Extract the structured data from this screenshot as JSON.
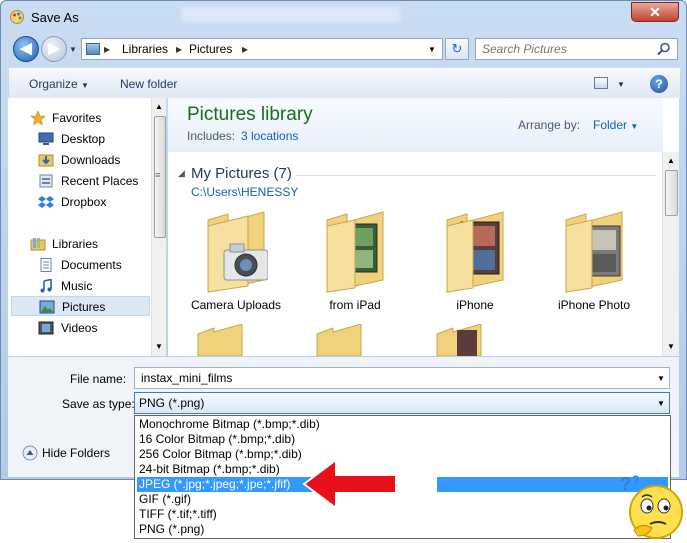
{
  "window": {
    "title": "Save As",
    "close_glyph": "✕"
  },
  "nav": {
    "back_glyph": "◀",
    "forward_glyph": "▶"
  },
  "address": {
    "crumbs": [
      "Libraries",
      "Pictures"
    ],
    "separator": "▸",
    "refresh_glyph": "↻"
  },
  "search": {
    "placeholder": "Search Pictures"
  },
  "toolbar": {
    "organize_label": "Organize",
    "new_folder_label": "New folder",
    "help_glyph": "?"
  },
  "sidebar": {
    "items": [
      {
        "label": "Favorites",
        "icon": "star-icon",
        "group": true
      },
      {
        "label": "Desktop",
        "icon": "desktop-icon"
      },
      {
        "label": "Downloads",
        "icon": "downloads-icon"
      },
      {
        "label": "Recent Places",
        "icon": "recent-places-icon"
      },
      {
        "label": "Dropbox",
        "icon": "dropbox-icon"
      },
      {
        "label": "Libraries",
        "icon": "libraries-icon",
        "group": true
      },
      {
        "label": "Documents",
        "icon": "documents-icon"
      },
      {
        "label": "Music",
        "icon": "music-icon"
      },
      {
        "label": "Pictures",
        "icon": "pictures-icon",
        "selected": true
      },
      {
        "label": "Videos",
        "icon": "videos-icon"
      }
    ]
  },
  "library": {
    "title": "Pictures library",
    "includes_label": "Includes:",
    "includes_link": "3 locations",
    "arrange_label": "Arrange by:",
    "arrange_value": "Folder"
  },
  "group": {
    "heading": "My Pictures (7)",
    "path": "C:\\Users\\HENESSY"
  },
  "folders": [
    {
      "label": "Camera Uploads",
      "overlay": "camera"
    },
    {
      "label": "from iPad",
      "overlay": "photos"
    },
    {
      "label": "iPhone",
      "overlay": "photos"
    },
    {
      "label": "iPhone Photo",
      "overlay": "photos"
    }
  ],
  "form": {
    "file_name_label": "File name:",
    "file_name_value": "instax_mini_films",
    "save_type_label": "Save as type:",
    "save_type_value": "PNG (*.png)",
    "hide_folders_label": "Hide Folders"
  },
  "save_type_options": [
    "Monochrome Bitmap (*.bmp;*.dib)",
    "16 Color Bitmap (*.bmp;*.dib)",
    "256 Color Bitmap (*.bmp;*.dib)",
    "24-bit Bitmap (*.bmp;*.dib)",
    "JPEG (*.jpg;*.jpeg;*.jpe;*.jfif)",
    "GIF (*.gif)",
    "TIFF (*.tif;*.tiff)",
    "PNG (*.png)"
  ],
  "highlighted_option": "JPEG (*.jpg;*.jpeg;*.jpe;*.jfif)",
  "colors": {
    "accent": "#3399ff",
    "library_title": "#1e6b1e",
    "link": "#1560bd",
    "annotation_arrow": "#e8101a"
  }
}
